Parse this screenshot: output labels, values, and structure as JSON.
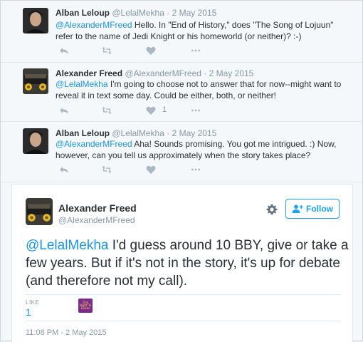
{
  "replies": [
    {
      "name": "Alban Leloup",
      "handle": "@LelalMekha",
      "dot": "·",
      "date": "2 May 2015",
      "mention": "@AlexanderMFreed",
      "text": " Hello. In \"End of History,\" does \"The Song of Lojuun\" refer to the name of Jedi Knight or his homeworld (or neither)? :-)",
      "like_count": ""
    },
    {
      "name": "Alexander Freed",
      "handle": "@AlexanderMFreed",
      "dot": "·",
      "date": "2 May 2015",
      "mention": "@LelalMekha",
      "text": " I'm going to choose not to answer that for now--might want to reveal it in text some day. Could be either, both, or neither!",
      "like_count": "1"
    },
    {
      "name": "Alban Leloup",
      "handle": "@LelalMekha",
      "dot": "·",
      "date": "2 May 2015",
      "mention": "@AlexanderMFreed",
      "text": " Aha! Sounds promising. You got me intrigued. :) Now, however, can you tell us approximately when the story takes place?",
      "like_count": ""
    }
  ],
  "main_tweet": {
    "name": "Alexander Freed",
    "handle": "@AlexanderMFreed",
    "follow_label": "Follow",
    "mention": "@LelalMekha",
    "text": " I'd guess around 10 BBY, give or take a few years. But if it's not in the story, it's up for debate (and therefore not my call).",
    "like_label": "LIKE",
    "like_value": "1",
    "liker_badge_text": "Tidy Night To Geeks",
    "timestamp": "11:08 PM - 2 May 2015"
  },
  "icons": {
    "reply": "reply-icon",
    "retweet": "retweet-icon",
    "like": "heart-icon",
    "more": "more-icon",
    "gear": "gear-icon",
    "follow": "add-user-icon"
  },
  "colors": {
    "link": "#1b95e0",
    "follow": "#1da1f2",
    "muted": "#8899a6",
    "background": "#f5f8fa"
  }
}
